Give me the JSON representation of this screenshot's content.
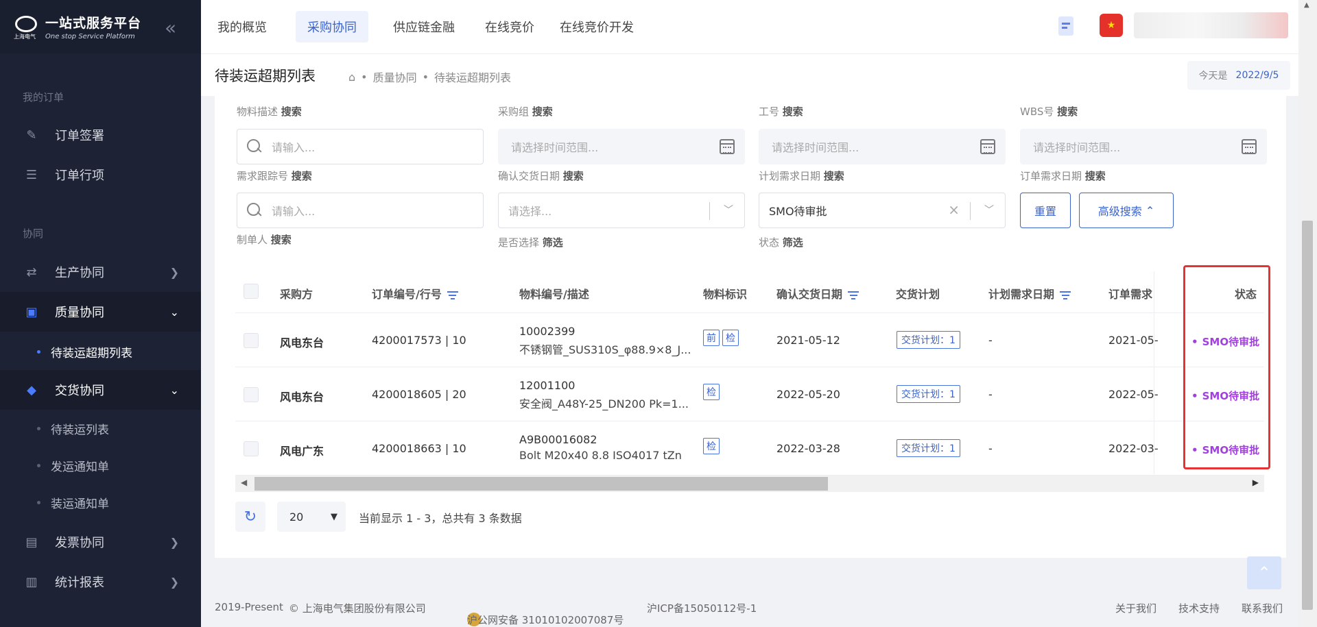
{
  "brand": {
    "name": "一站式服务平台",
    "tagline": "One stop Service Platform",
    "sub": "上海电气"
  },
  "sidebar": {
    "section1": "我的订单",
    "section2": "协同",
    "items": {
      "sign": "订单签署",
      "lines": "订单行项",
      "production": "生产协同",
      "quality": "质量协同",
      "quality_sub": "待装运超期列表",
      "delivery": "交货协同",
      "delivery_sub1": "待装运列表",
      "delivery_sub2": "发运通知单",
      "delivery_sub3": "装运通知单",
      "invoice": "发票协同",
      "report": "统计报表"
    }
  },
  "topnav": {
    "tabs": [
      "我的概览",
      "采购协同",
      "供应链金融",
      "在线竞价",
      "在线竞价开发"
    ]
  },
  "subheader": {
    "title": "待装运超期列表",
    "breadcrumb": [
      "质量协同",
      "待装运超期列表"
    ],
    "today_label": "今天是",
    "today_value": "2022/9/5"
  },
  "filters": {
    "row1": [
      {
        "label": "物料描述",
        "action": "搜索"
      },
      {
        "label": "采购组",
        "action": "搜索"
      },
      {
        "label": "工号",
        "action": "搜索"
      },
      {
        "label": "WBS号",
        "action": "搜索"
      }
    ],
    "row2_inputs": {
      "search_placeholder": "请输入...",
      "date_placeholder": "请选择时间范围..."
    },
    "row2_labels": [
      {
        "label": "需求跟踪号",
        "action": "搜索"
      },
      {
        "label": "确认交货日期",
        "action": "搜索"
      },
      {
        "label": "计划需求日期",
        "action": "搜索"
      },
      {
        "label": "订单需求日期",
        "action": "搜索"
      }
    ],
    "row3": {
      "search_placeholder": "请输入...",
      "select_placeholder": "请选择...",
      "status_value": "SMO待审批"
    },
    "row3_labels": [
      {
        "label": "制单人",
        "action": "搜索"
      },
      {
        "label": "是否选择",
        "action": "筛选"
      },
      {
        "label": "状态",
        "action": "筛选"
      }
    ],
    "reset": "重置",
    "advanced": "高级搜索"
  },
  "table": {
    "headers": {
      "buyer": "采购方",
      "order": "订单编号/行号",
      "material": "物料编号/描述",
      "mark": "物料标识",
      "confirm_date": "确认交货日期",
      "plan": "交货计划",
      "plan_date": "计划需求日期",
      "order_date": "订单需求",
      "status": "状态"
    },
    "rows": [
      {
        "buyer": "风电东台",
        "order": "4200017573 | 10",
        "mat_code": "10002399",
        "mat_desc": "不锈钢管_SUS310S_φ88.9×8_J...",
        "tags": [
          "前",
          "检"
        ],
        "confirm_date": "2021-05-12",
        "plan": "交货计划：1",
        "plan_date": "-",
        "order_date": "2021-05-",
        "status": "SMO待审批"
      },
      {
        "buyer": "风电东台",
        "order": "4200018605 | 20",
        "mat_code": "12001100",
        "mat_desc": "安全阀_A48Y-25_DN200 Pk=1...",
        "tags": [
          "检"
        ],
        "confirm_date": "2022-05-20",
        "plan": "交货计划：1",
        "plan_date": "-",
        "order_date": "2022-05-",
        "status": "SMO待审批"
      },
      {
        "buyer": "风电广东",
        "order": "4200018663 | 10",
        "mat_code": "A9B00016082",
        "mat_desc": "Bolt M20x40 8.8 ISO4017 tZn",
        "tags": [
          "检"
        ],
        "confirm_date": "2022-03-28",
        "plan": "交货计划：1",
        "plan_date": "-",
        "order_date": "2022-03-",
        "status": "SMO待审批"
      }
    ]
  },
  "pagination": {
    "page_size": "20",
    "info": "当前显示 1 - 3，总共有 3 条数据"
  },
  "footer": {
    "copyright": "2019-Present",
    "company": "© 上海电气集团股份有限公司",
    "police": "沪公网安备 31010102007087号",
    "icp": "沪ICP备15050112号-1",
    "links": [
      "关于我们",
      "技术支持",
      "联系我们"
    ]
  },
  "colors": {
    "accent": "#3b63c9",
    "status": "#a23fe0",
    "sidebar": "#1d2234",
    "highlight": "#e53333"
  }
}
